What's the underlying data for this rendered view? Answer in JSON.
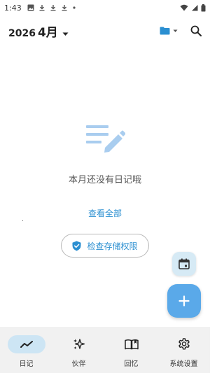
{
  "status_bar": {
    "time": "1:43"
  },
  "header": {
    "year": "2026",
    "month": "4月"
  },
  "empty_state": {
    "message": "本月还没有日记哦",
    "view_all": "查看全部",
    "check_storage": "检查存储权限"
  },
  "nav": {
    "items": [
      {
        "label": "日记",
        "icon": "trend-line-icon"
      },
      {
        "label": "伙伴",
        "icon": "sparkles-icon"
      },
      {
        "label": "回忆",
        "icon": "book-icon"
      },
      {
        "label": "系统设置",
        "icon": "gear-icon"
      }
    ]
  },
  "colors": {
    "accent": "#2b8fd1",
    "fab": "#5aa9e9",
    "fab_secondary": "#d6eaf5",
    "nav_bg": "#f1f1f1",
    "nav_active": "#cde5f4"
  }
}
